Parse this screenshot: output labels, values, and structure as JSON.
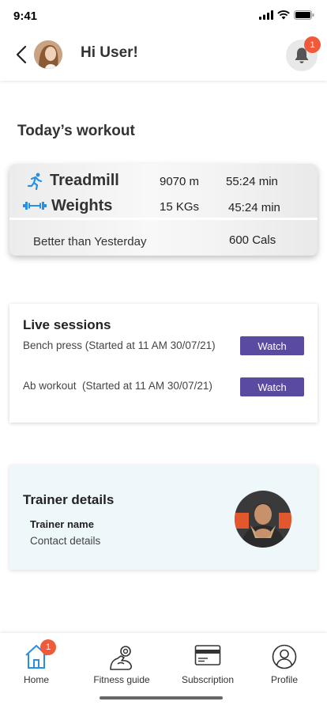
{
  "status_bar": {
    "time": "9:41",
    "icons": [
      "signal-icon",
      "wifi-icon",
      "battery-icon"
    ]
  },
  "header": {
    "greeting": "Hi User!",
    "notification_count": "1",
    "icons": [
      "back-chevron-icon",
      "bell-icon"
    ]
  },
  "workout": {
    "title": "Today’s workout",
    "items": [
      {
        "name": "Treadmill",
        "amount": "9070 m",
        "duration": "55:24 min",
        "icon": "running-icon"
      },
      {
        "name": "Weights",
        "amount": "15 KGs",
        "duration": "45:24 min",
        "icon": "dumbbell-icon"
      }
    ],
    "summary_label": "Better than Yesterday",
    "summary_value": "600 Cals"
  },
  "live_sessions": {
    "title": "Live sessions",
    "sessions": [
      {
        "text": "Bench press (Started at 11 AM 30/07/21)",
        "button": "Watch"
      },
      {
        "text": "Ab workout  (Started at 11 AM 30/07/21)",
        "button": "Watch"
      }
    ]
  },
  "trainer": {
    "title": "Trainer details",
    "name_label": "Trainer name",
    "contact_label": "Contact details"
  },
  "tabbar": {
    "tabs": [
      {
        "label": "Home",
        "icon": "home-icon",
        "badge": "1"
      },
      {
        "label": "Fitness guide",
        "icon": "bicep-icon"
      },
      {
        "label": "Subscription",
        "icon": "card-icon"
      },
      {
        "label": "Profile",
        "icon": "profile-icon"
      }
    ]
  },
  "colors": {
    "accent": "#5a4aa0",
    "badge": "#f05a3a",
    "icon_blue": "#2a8fe0",
    "trainer_bg": "#eef8fb"
  }
}
